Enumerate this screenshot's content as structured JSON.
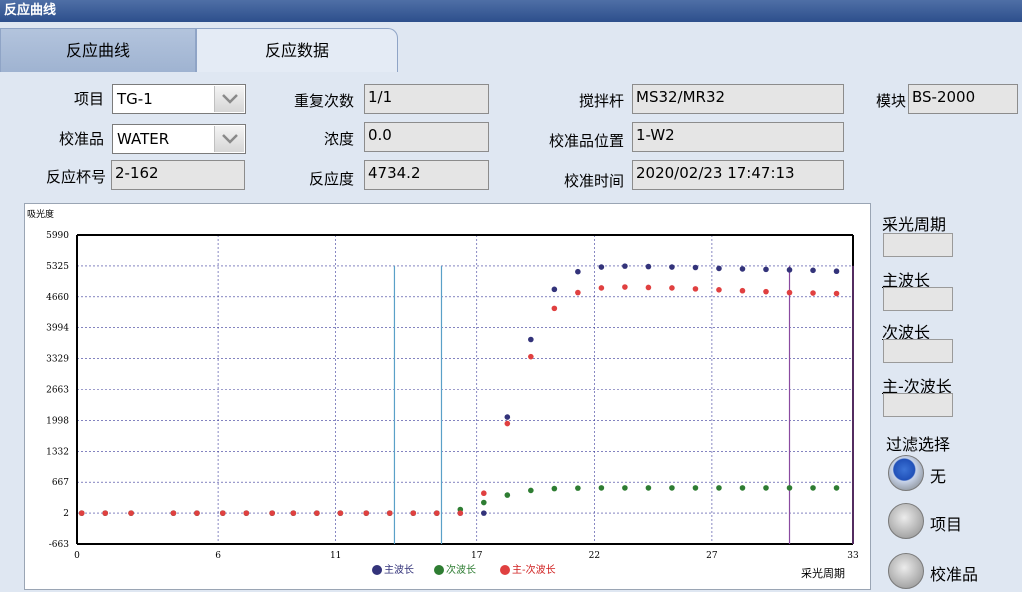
{
  "window": {
    "title": "反应曲线"
  },
  "tabs": [
    {
      "label": "反应曲线"
    },
    {
      "label": "反应数据"
    }
  ],
  "form": {
    "item_label": "项目",
    "item_value": "TG-1",
    "calibrator_label": "校准品",
    "calibrator_value": "WATER",
    "cup_label": "反应杯号",
    "cup_value": "2-162",
    "repeat_label": "重复次数",
    "repeat_value": "1/1",
    "conc_label": "浓度",
    "conc_value": "0.0",
    "reactivity_label": "反应度",
    "reactivity_value": "4734.2",
    "mixer_label": "搅拌杆",
    "mixer_value": "MS32/MR32",
    "cal_pos_label": "校准品位置",
    "cal_pos_value": "1-W2",
    "cal_time_label": "校准时间",
    "cal_time_value": "2020/02/23 17:47:13",
    "module_label": "模块",
    "module_value": "BS-2000"
  },
  "side": {
    "period_label": "采光周期",
    "main_wave_label": "主波长",
    "sub_wave_label": "次波长",
    "diff_wave_label": "主-次波长",
    "filter_label": "过滤选择",
    "filter_options": [
      "无",
      "项目",
      "校准品"
    ],
    "filter_selected": 0
  },
  "chart_data": {
    "type": "scatter",
    "ylabel": "吸光度",
    "xlabel": "采光周期",
    "xlim": [
      0,
      33
    ],
    "ylim": [
      -663,
      5990
    ],
    "yticks": [
      "5990",
      "5325",
      "4660",
      "3994",
      "3329",
      "2663",
      "1998",
      "1332",
      "667",
      "2",
      "-663"
    ],
    "xticks": [
      "0",
      "6",
      "11",
      "17",
      "22",
      "27",
      "33"
    ],
    "legend": [
      "主波长",
      "次波长",
      "主-次波长"
    ],
    "colors": {
      "main": "#33337a",
      "sub": "#2e7d32",
      "diff": "#e04040"
    },
    "vlines": [
      {
        "x": 13.5,
        "color": "#5aa0c8"
      },
      {
        "x": 15.5,
        "color": "#5aa0c8"
      },
      {
        "x": 30.3,
        "color": "#8a4aa0"
      },
      {
        "x": 33.0,
        "color": "#8a4aa0"
      }
    ],
    "series": [
      {
        "name": "主波长",
        "x": [
          0.2,
          1.2,
          2.3,
          4.1,
          5.1,
          6.2,
          7.2,
          8.3,
          9.2,
          10.2,
          11.2,
          12.3,
          13.3,
          14.3,
          15.3,
          16.3,
          17.3,
          18.3,
          19.3,
          20.3,
          21.3,
          22.3,
          23.3,
          24.3,
          25.3,
          26.3,
          27.3,
          28.3,
          29.3,
          30.3,
          31.3,
          32.3
        ],
        "y": [
          2,
          2,
          2,
          2,
          2,
          2,
          2,
          2,
          2,
          2,
          2,
          2,
          2,
          2,
          2,
          2,
          2,
          2070,
          3740,
          4820,
          5200,
          5300,
          5320,
          5310,
          5300,
          5290,
          5270,
          5260,
          5250,
          5240,
          5230,
          5210
        ]
      },
      {
        "name": "次波长",
        "x": [
          0.2,
          1.2,
          2.3,
          4.1,
          5.1,
          6.2,
          7.2,
          8.3,
          9.2,
          10.2,
          11.2,
          12.3,
          13.3,
          14.3,
          15.3,
          16.3,
          17.3,
          18.3,
          19.3,
          20.3,
          21.3,
          22.3,
          23.3,
          24.3,
          25.3,
          26.3,
          27.3,
          28.3,
          29.3,
          30.3,
          31.3,
          32.3
        ],
        "y": [
          2,
          2,
          2,
          2,
          2,
          2,
          2,
          2,
          2,
          2,
          2,
          2,
          2,
          2,
          2,
          80,
          230,
          390,
          490,
          530,
          540,
          545,
          545,
          545,
          545,
          545,
          545,
          545,
          545,
          545,
          545,
          545
        ]
      },
      {
        "name": "主-次波长",
        "x": [
          0.2,
          1.2,
          2.3,
          4.1,
          5.1,
          6.2,
          7.2,
          8.3,
          9.2,
          10.2,
          11.2,
          12.3,
          13.3,
          14.3,
          15.3,
          16.3,
          17.3,
          18.3,
          19.3,
          20.3,
          21.3,
          22.3,
          23.3,
          24.3,
          25.3,
          26.3,
          27.3,
          28.3,
          29.3,
          30.3,
          31.3,
          32.3
        ],
        "y": [
          2,
          2,
          2,
          2,
          2,
          2,
          2,
          2,
          2,
          2,
          2,
          2,
          2,
          2,
          2,
          2,
          430,
          1930,
          3370,
          4410,
          4750,
          4850,
          4870,
          4860,
          4850,
          4830,
          4810,
          4790,
          4770,
          4750,
          4740,
          4730
        ]
      }
    ]
  }
}
